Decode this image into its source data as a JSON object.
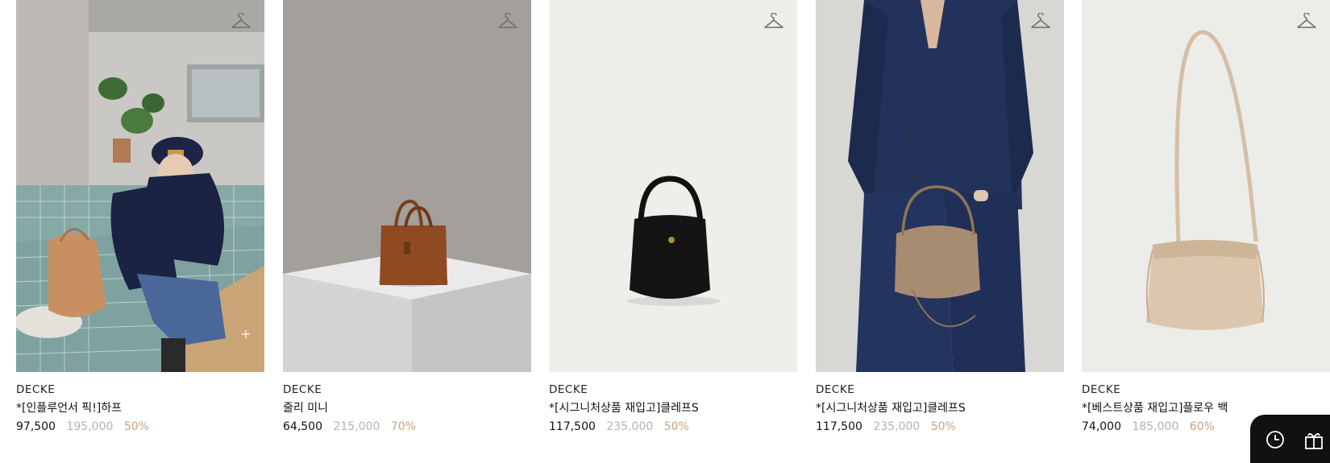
{
  "products": [
    {
      "brand": "DECKE",
      "name": "*[인플루언서 픽!]하프",
      "sale_price": "97,500",
      "original_price": "195,000",
      "discount": "50%",
      "image": "woman-seated-with-tan-bucket-bag"
    },
    {
      "brand": "DECKE",
      "name": "줄리 미니",
      "sale_price": "64,500",
      "original_price": "215,000",
      "discount": "70%",
      "image": "brown-leather-tote-on-plinth"
    },
    {
      "brand": "DECKE",
      "name": "*[시그니처상품 재입고]클레프S",
      "sale_price": "117,500",
      "original_price": "235,000",
      "discount": "50%",
      "image": "black-leather-bucket-bag"
    },
    {
      "brand": "DECKE",
      "name": "*[시그니처상품 재입고]클레프S",
      "sale_price": "117,500",
      "original_price": "235,000",
      "discount": "50%",
      "image": "model-holding-taupe-bag"
    },
    {
      "brand": "DECKE",
      "name": "*[베스트상품 재입고]플로우 백",
      "sale_price": "74,000",
      "original_price": "185,000",
      "discount": "60%",
      "image": "beige-drawstring-crossbody-bag"
    }
  ],
  "icons": {
    "wishlist": "hanger-icon",
    "recent": "clock-icon",
    "gift": "gift-icon"
  },
  "colors": {
    "discount": "#c9a27e",
    "original_price": "#b3b3b3",
    "floating_bar": "#111111"
  }
}
